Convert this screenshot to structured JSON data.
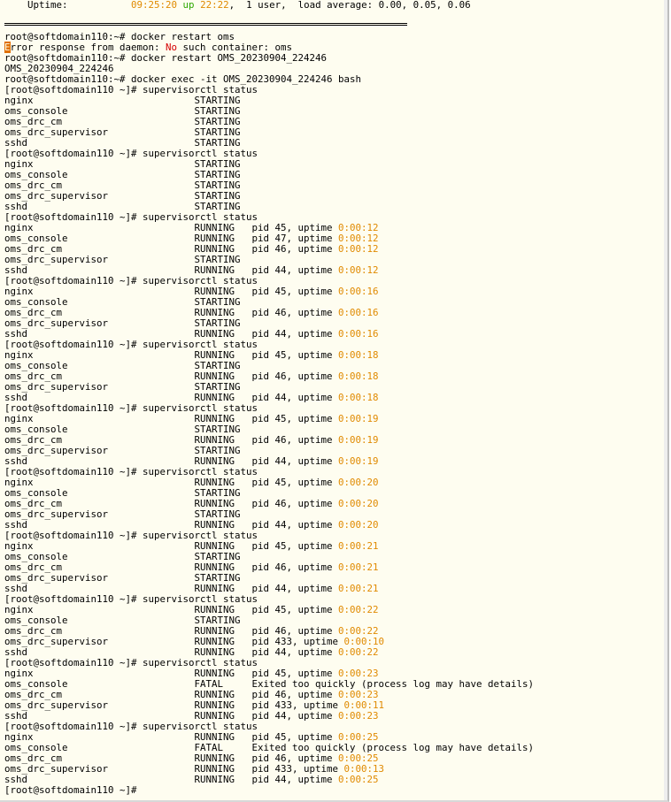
{
  "terminal": {
    "uptime_line": {
      "label": "    Uptime:           ",
      "time": "09:25:20",
      "up": "up",
      "duration": "22:22",
      "rest": ",  1 user,  load average: 0.00, 0.05, 0.06"
    },
    "error_line": {
      "first_char": "E",
      "part1": "rror response from daemon: ",
      "no": "No",
      "part2": " such container: oms"
    },
    "lines": [
      "",
      "===SEP===",
      "root@softdomain110:~# docker restart oms",
      "===ERROR===",
      "root@softdomain110:~# docker restart OMS_20230904_224246",
      "OMS_20230904_224246",
      "root@softdomain110:~# docker exec -it OMS_20230904_224246 bash",
      "[root@softdomain110 ~]# supervisorctl status",
      "nginx                            STARTING",
      "oms_console                      STARTING",
      "oms_drc_cm                       STARTING",
      "oms_drc_supervisor               STARTING",
      "sshd                             STARTING",
      "[root@softdomain110 ~]# supervisorctl status",
      "nginx                            STARTING",
      "oms_console                      STARTING",
      "oms_drc_cm                       STARTING",
      "oms_drc_supervisor               STARTING",
      "sshd                             STARTING",
      "[root@softdomain110 ~]# supervisorctl status",
      "nginx                            RUNNING   pid 45, uptime |0:00:12",
      "oms_console                      RUNNING   pid 47, uptime |0:00:12",
      "oms_drc_cm                       RUNNING   pid 46, uptime |0:00:12",
      "oms_drc_supervisor               STARTING",
      "sshd                             RUNNING   pid 44, uptime |0:00:12",
      "[root@softdomain110 ~]# supervisorctl status",
      "nginx                            RUNNING   pid 45, uptime |0:00:16",
      "oms_console                      STARTING",
      "oms_drc_cm                       RUNNING   pid 46, uptime |0:00:16",
      "oms_drc_supervisor               STARTING",
      "sshd                             RUNNING   pid 44, uptime |0:00:16",
      "[root@softdomain110 ~]# supervisorctl status",
      "nginx                            RUNNING   pid 45, uptime |0:00:18",
      "oms_console                      STARTING",
      "oms_drc_cm                       RUNNING   pid 46, uptime |0:00:18",
      "oms_drc_supervisor               STARTING",
      "sshd                             RUNNING   pid 44, uptime |0:00:18",
      "[root@softdomain110 ~]# supervisorctl status",
      "nginx                            RUNNING   pid 45, uptime |0:00:19",
      "oms_console                      STARTING",
      "oms_drc_cm                       RUNNING   pid 46, uptime |0:00:19",
      "oms_drc_supervisor               STARTING",
      "sshd                             RUNNING   pid 44, uptime |0:00:19",
      "[root@softdomain110 ~]# supervisorctl status",
      "nginx                            RUNNING   pid 45, uptime |0:00:20",
      "oms_console                      STARTING",
      "oms_drc_cm                       RUNNING   pid 46, uptime |0:00:20",
      "oms_drc_supervisor               STARTING",
      "sshd                             RUNNING   pid 44, uptime |0:00:20",
      "[root@softdomain110 ~]# supervisorctl status",
      "nginx                            RUNNING   pid 45, uptime |0:00:21",
      "oms_console                      STARTING",
      "oms_drc_cm                       RUNNING   pid 46, uptime |0:00:21",
      "oms_drc_supervisor               STARTING",
      "sshd                             RUNNING   pid 44, uptime |0:00:21",
      "[root@softdomain110 ~]# supervisorctl status",
      "nginx                            RUNNING   pid 45, uptime |0:00:22",
      "oms_console                      STARTING",
      "oms_drc_cm                       RUNNING   pid 46, uptime |0:00:22",
      "oms_drc_supervisor               RUNNING   pid 433, uptime |0:00:10",
      "sshd                             RUNNING   pid 44, uptime |0:00:22",
      "[root@softdomain110 ~]# supervisorctl status",
      "nginx                            RUNNING   pid 45, uptime |0:00:23",
      "oms_console                      FATAL     Exited too quickly (process log may have details)",
      "oms_drc_cm                       RUNNING   pid 46, uptime |0:00:23",
      "oms_drc_supervisor               RUNNING   pid 433, uptime |0:00:11",
      "sshd                             RUNNING   pid 44, uptime |0:00:23",
      "[root@softdomain110 ~]# supervisorctl status",
      "nginx                            RUNNING   pid 45, uptime |0:00:25",
      "oms_console                      FATAL     Exited too quickly (process log may have details)",
      "oms_drc_cm                       RUNNING   pid 46, uptime |0:00:25",
      "oms_drc_supervisor               RUNNING   pid 433, uptime |0:00:13",
      "sshd                             RUNNING   pid 44, uptime |0:00:25",
      "[root@softdomain110 ~]#"
    ]
  },
  "colors": {
    "background": "#fefdf0",
    "text": "#000000",
    "uptime_highlight": "#e08a00",
    "up_word": "#2fa800",
    "error_red": "#d40000"
  }
}
